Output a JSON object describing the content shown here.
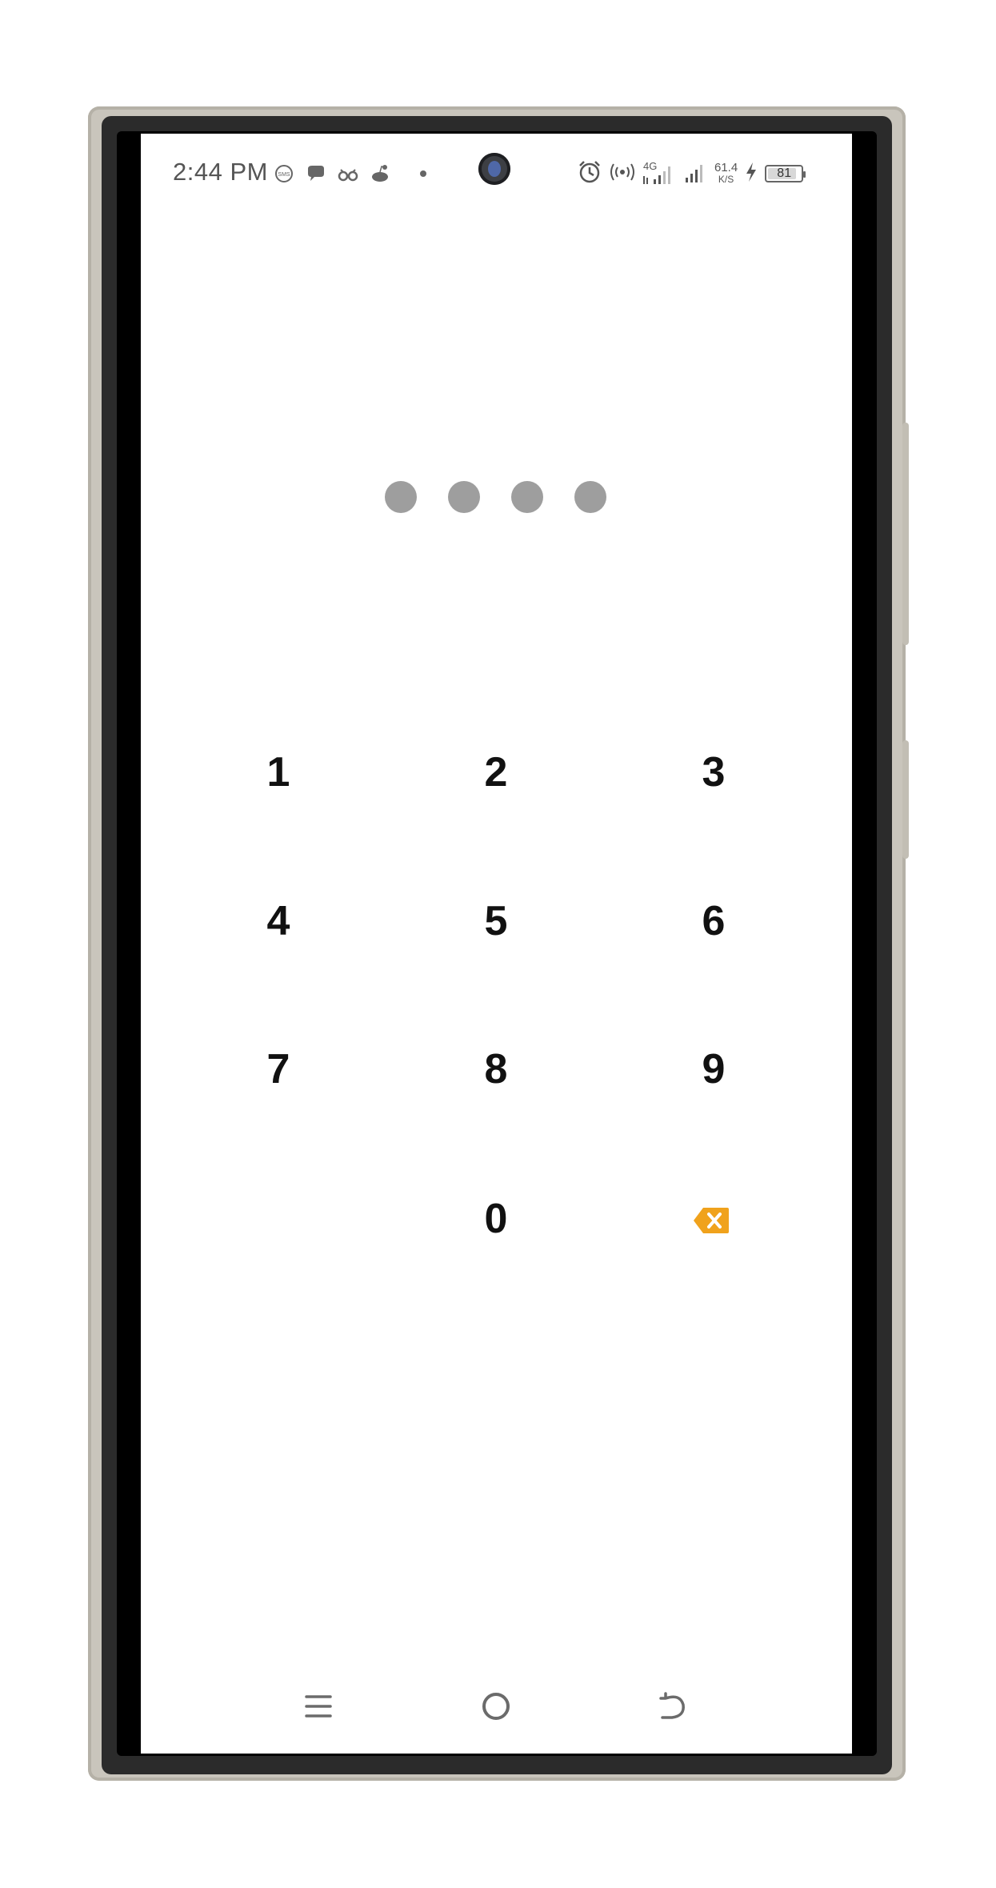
{
  "status_bar": {
    "time": "2:44 PM",
    "network_type": "4G",
    "net_speed_value": "61.4",
    "net_speed_unit": "K/S",
    "battery_level": "81",
    "notification_icons": [
      "chat-bubble-icon",
      "message-icon",
      "glasses-icon",
      "reddit-icon",
      "dot-icon"
    ],
    "system_icons": [
      "alarm-icon",
      "hotspot-icon",
      "signal-4g-icon",
      "signal-icon",
      "charging-icon",
      "battery-icon"
    ]
  },
  "pin_entry": {
    "entered_digits": 4
  },
  "keypad": {
    "keys": [
      "1",
      "2",
      "3",
      "4",
      "5",
      "6",
      "7",
      "8",
      "9",
      "0"
    ],
    "backspace_icon": "backspace-icon",
    "accent_color": "#f0a21c"
  },
  "nav_bar": {
    "buttons": [
      "recents-icon",
      "home-icon",
      "back-icon"
    ]
  },
  "colors": {
    "screen_bg": "#ffffff",
    "dot_color": "#9e9e9e",
    "key_text": "#111111",
    "frame": "#c9c5bc"
  }
}
